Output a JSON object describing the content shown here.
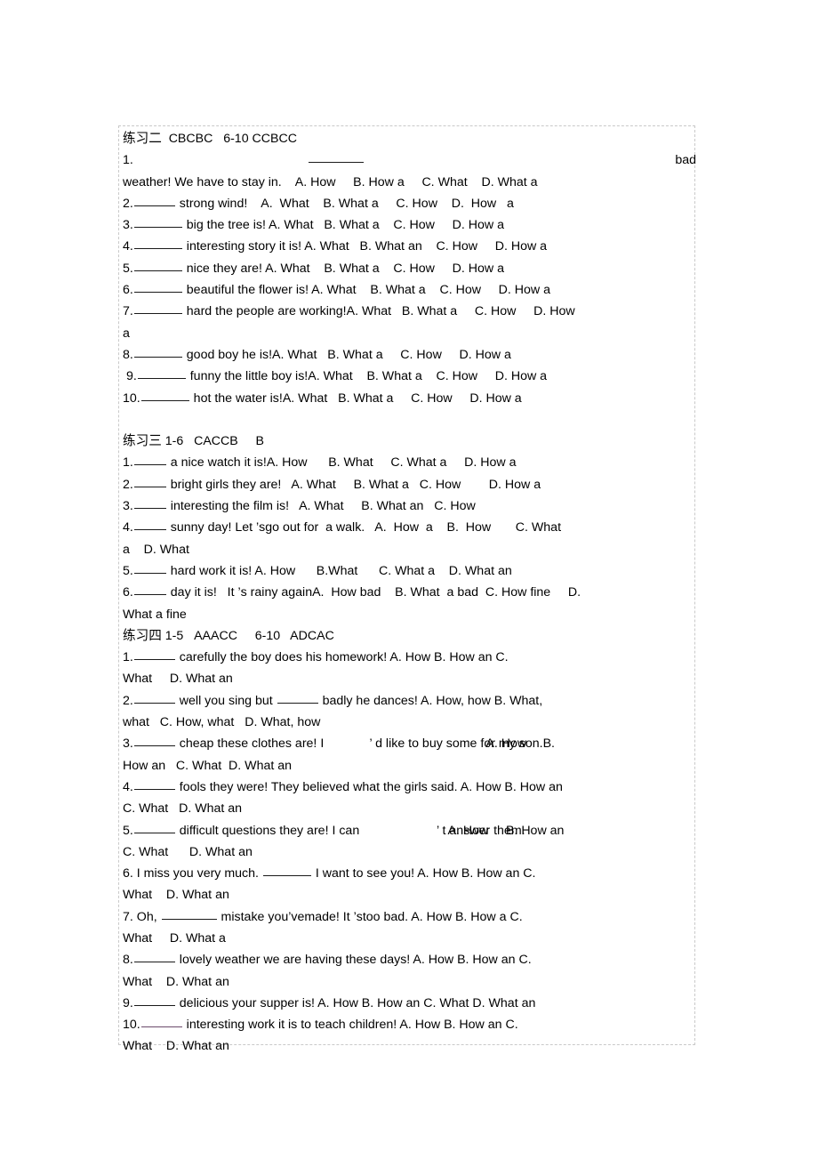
{
  "document": {
    "sections": [
      {
        "id": "section-2",
        "heading": {
          "title": "练习二",
          "answers_1_5": "CBCBC",
          "answers_6_10_label": "6-10",
          "answers_6_10": "CCBCC",
          "full": "练习二  CBCBC    6-10 CCBCC"
        },
        "questions": [
          {
            "number": "1.",
            "tail": "bad",
            "line2": "weather! We have to stay in.    A. How     B. How a     C. What    D. What a"
          },
          {
            "number": "2.",
            "stem": " strong wind!    A.  What    B. What a     C. How    D.  How   a"
          },
          {
            "number": "3.",
            "stem": " big the tree is! A. What   B. What a    C. How     D. How a"
          },
          {
            "number": "4.",
            "stem": " interesting story it is! A. What   B. What an    C. How     D. How a"
          },
          {
            "number": "5.",
            "stem": " nice they are! A. What    B. What a    C. How     D. How a"
          },
          {
            "number": "6.",
            "stem": " beautiful the flower is! A. What    B. What a    C. How     D. How a"
          },
          {
            "number": "7.",
            "stem": " hard the people are working!A. What   B. What a     C. How     D. How",
            "wrap": "a"
          },
          {
            "number": "8.",
            "stem": " good boy he is!A. What   B. What a     C. How     D. How a"
          },
          {
            "number": " 9.",
            "stem": " funny the little boy is!A. What    B. What a    C. How     D. How a"
          },
          {
            "number": "10.",
            "stem": " hot the water is!A. What   B. What a     C. How     D. How a"
          }
        ]
      },
      {
        "id": "section-3",
        "heading": {
          "title": "练习三",
          "range": "1-6",
          "answers": "CACCB",
          "extra": "B",
          "full": "练习三 1-6   CACCB     B"
        },
        "questions": [
          {
            "number": "1.",
            "stem": " a nice watch it is!A. How      B. What     C. What a     D. How a"
          },
          {
            "number": "2.",
            "stem": " bright girls they are!   A. What     B. What a   C. How        D. How a"
          },
          {
            "number": "3.",
            "stem": " interesting the film is!   A. What     B. What an   C. How"
          },
          {
            "number": "4.",
            "stem_a": " sunny day! Let ",
            "apostrophe": "’",
            "stem_b": "s",
            "stem_c": "go out for  a walk.   A.  How  a    B.  How       C. What",
            "wrap": "a    D. What"
          },
          {
            "number": "5.",
            "stem": " hard work it is! A. How      B.What      C. What a    D. What an"
          },
          {
            "number": "6.",
            "stem_a": " day it is!   It ",
            "apostrophe": "’",
            "stem_b": "s rainy again",
            "stem_c": "A.  How bad    B. What  a bad  C. How fine     D.",
            "wrap": "What a fine"
          }
        ]
      },
      {
        "id": "section-4",
        "heading": {
          "title": "练习四",
          "range_1": "1-5",
          "answers_1": "AAACC",
          "range_2": "6-10",
          "answers_2": "ADCAC",
          "full": "练习四 1-5   AAACC     6-10   ADCAC"
        },
        "questions": [
          {
            "number": "1.",
            "stem": " carefully  the  boy  does his  homework!   A.  How     B.  How  an  C.",
            "wrap": "What     D. What an"
          },
          {
            "number": "2.",
            "stem_a": " well  you sing but ",
            "stem_b": " badly he dances! A.  How, how    B.  What,",
            "wrap": "what   C. How, what   D. What, how"
          },
          {
            "number": "3.",
            "stem_a": " cheap these clothes are! I ",
            "apostrophe": "’",
            "stem_b": " d like to buy some ",
            "overlap_under": "for my son.",
            "overlap_over": "A. How",
            "stem_c": "B.",
            "wrap": "How an   C. What  D. What an"
          },
          {
            "number": "4.",
            "stem": " fools they were! They believed what the girls said.  A. How    B. How an",
            "wrap": "C. What   D. What an"
          },
          {
            "number": "5.",
            "stem_a": " difficult questions they are! I can",
            "apostrophe": "’",
            "overlap_under": "t answer them.",
            "overlap_over": "A. How     B. How an",
            "wrap": "C. What      D. What an"
          },
          {
            "number": "6.",
            "stem_a": "I miss  you very much. ",
            "stem_b": " I want  to see you!   A. How      B. How an    C.",
            "wrap": "What    D. What an"
          },
          {
            "number": "7.",
            "stem_a": "Oh, ",
            "stem_b": " mistake you",
            "apostrophe": "’",
            "stem_c": "ve",
            "stem_d": "made! It ",
            "apostrophe2": "’",
            "stem_e": "s",
            "stem_f": "too bad.   A.  How      B.  How  a  C.",
            "wrap": "What     D. What a"
          },
          {
            "number": "8.",
            "stem": " lovely  weather we are having these days!   A.  How     B.  How  an   C.",
            "wrap": "What    D. What an"
          },
          {
            "number": "9.",
            "stem": " delicious your supper is!  A. How     B. How an    C. What     D. What an"
          },
          {
            "number": "10.",
            "stem": " interesting  work  it  is  to teach children!    A.  How      B.  How  an   C.",
            "wrap": "What    D. What an"
          }
        ]
      }
    ]
  }
}
